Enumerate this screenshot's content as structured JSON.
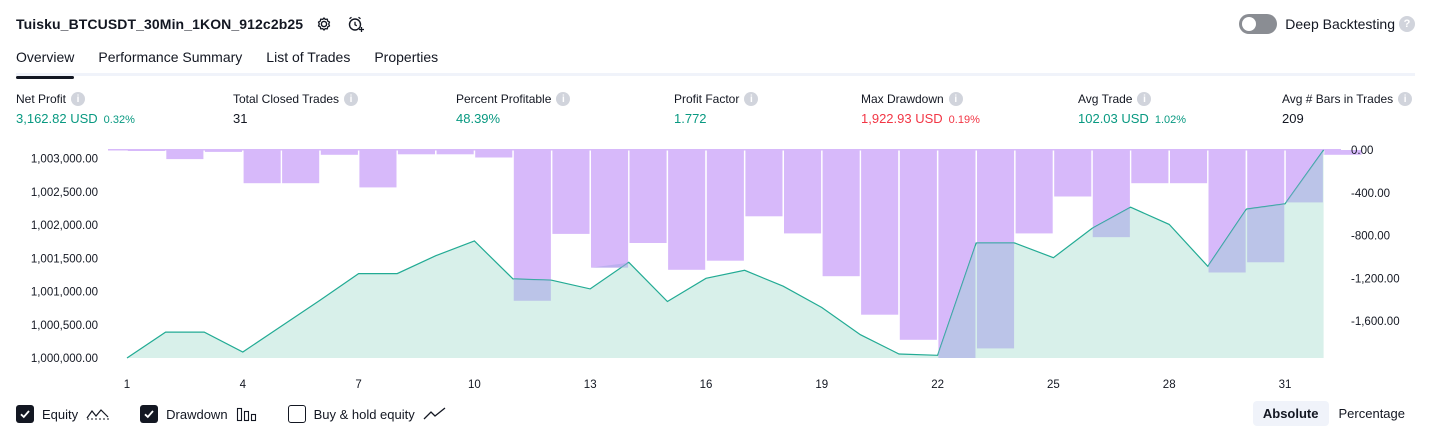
{
  "header": {
    "strategy_title": "Tuisku_BTCUSDT_30Min_1KON_912c2b25",
    "deep_backtesting_label": "Deep Backtesting",
    "deep_backtesting_enabled": false,
    "help_glyph": "?"
  },
  "tabs": [
    {
      "label": "Overview",
      "active": true
    },
    {
      "label": "Performance Summary",
      "active": false
    },
    {
      "label": "List of Trades",
      "active": false
    },
    {
      "label": "Properties",
      "active": false
    }
  ],
  "metrics": {
    "info_glyph": "i",
    "net_profit": {
      "label": "Net Profit",
      "value": "3,162.82 USD",
      "pct": "0.32%"
    },
    "total_closed_trades": {
      "label": "Total Closed Trades",
      "value": "31"
    },
    "percent_profitable": {
      "label": "Percent Profitable",
      "value": "48.39%"
    },
    "profit_factor": {
      "label": "Profit Factor",
      "value": "1.772"
    },
    "max_drawdown": {
      "label": "Max Drawdown",
      "value": "1,922.93 USD",
      "pct": "0.19%"
    },
    "avg_trade": {
      "label": "Avg Trade",
      "value": "102.03 USD",
      "pct": "1.02%"
    },
    "avg_bars": {
      "label": "Avg # Bars in Trades",
      "value": "209"
    }
  },
  "colors": {
    "green": "#089981",
    "red": "#f23645",
    "equity_line": "#22ab94",
    "equity_fill": "#d1ede6",
    "drawdown_bar": "#d7b9fa",
    "drawdown_bar_overlap": "#a8a8e6"
  },
  "chart_data": {
    "type": "line",
    "x_ticks": [
      "1",
      "4",
      "7",
      "10",
      "13",
      "16",
      "19",
      "22",
      "25",
      "28",
      "31"
    ],
    "left_axis": {
      "ticks": [
        "1,000,000.00",
        "1,000,500.00",
        "1,001,000.00",
        "1,001,500.00",
        "1,002,000.00",
        "1,002,500.00",
        "1,003,000.00"
      ],
      "ylim": [
        1000000,
        1003130
      ]
    },
    "right_axis": {
      "ticks": [
        "0.00",
        "-400.00",
        "-800.00",
        "-1,200.00",
        "-1,600.00"
      ],
      "ylim": [
        -1945,
        0
      ]
    },
    "series": [
      {
        "name": "Equity",
        "kind": "area",
        "x": [
          1,
          2,
          3,
          4,
          5,
          6,
          7,
          8,
          9,
          10,
          11,
          12,
          13,
          14,
          15,
          16,
          17,
          18,
          19,
          20,
          21,
          22,
          23,
          24,
          25,
          26,
          27,
          28,
          29,
          30,
          31,
          32
        ],
        "values": [
          1000000,
          1000390,
          1000390,
          1000090,
          1000480,
          1000870,
          1001270,
          1001270,
          1001540,
          1001760,
          1001190,
          1001170,
          1001040,
          1001440,
          1000850,
          1001200,
          1001320,
          1001080,
          1000760,
          1000350,
          1000060,
          1000040,
          1001730,
          1001730,
          1001510,
          1001950,
          1002270,
          1002010,
          1001380,
          1002240,
          1002320,
          1003130
        ]
      },
      {
        "name": "Drawdown",
        "kind": "bar",
        "x": [
          1,
          2,
          3,
          4,
          5,
          6,
          7,
          8,
          9,
          10,
          11,
          12,
          13,
          14,
          15,
          16,
          17,
          18,
          19,
          20,
          21,
          22,
          23,
          24,
          25,
          26,
          27,
          28,
          29,
          30,
          31,
          32
        ],
        "values": [
          -8,
          -85,
          -18,
          -310,
          -310,
          -45,
          -350,
          -40,
          -40,
          -70,
          -1410,
          -785,
          -1100,
          -870,
          -1120,
          -1035,
          -620,
          -780,
          -1180,
          -1540,
          -1775,
          -1945,
          -1855,
          -780,
          -435,
          -815,
          -310,
          -310,
          -1145,
          -1050,
          -490,
          -45
        ]
      }
    ]
  },
  "legend": {
    "equity": {
      "label": "Equity",
      "checked": true
    },
    "drawdown": {
      "label": "Drawdown",
      "checked": true
    },
    "buy_hold": {
      "label": "Buy & hold equity",
      "checked": false
    }
  },
  "view_toggle": {
    "absolute_label": "Absolute",
    "percentage_label": "Percentage",
    "selected": "absolute"
  }
}
